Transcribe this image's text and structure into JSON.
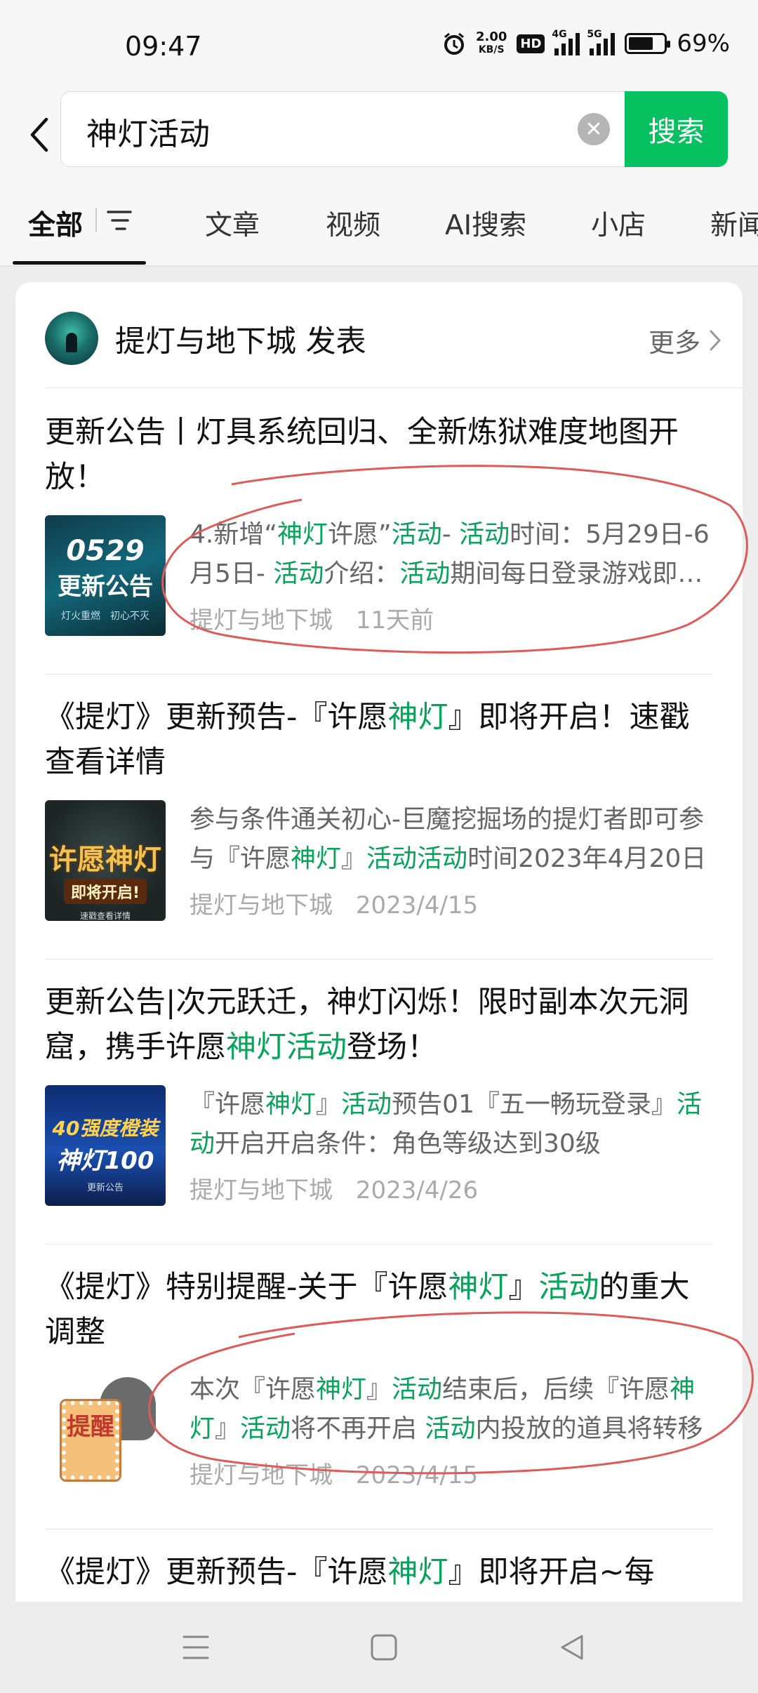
{
  "status_bar": {
    "time": "09:47",
    "net_speed_value": "2.00",
    "net_speed_unit": "KB/S",
    "hd_label": "HD",
    "signal_label_1": "4G",
    "signal_label_2": "5G",
    "battery": "69%"
  },
  "search": {
    "query": "神灯活动",
    "button_label": "搜索"
  },
  "tabs": [
    {
      "label": "全部",
      "active": true
    },
    {
      "label": "文章"
    },
    {
      "label": "视频"
    },
    {
      "label": "AI搜索"
    },
    {
      "label": "小店"
    },
    {
      "label": "新闻"
    }
  ],
  "account": {
    "name": "提灯与地下城 发表",
    "more_label": "更多"
  },
  "articles": [
    {
      "title": "更新公告丨灯具系统回归、全新炼狱难度地图开放！",
      "thumb": {
        "big": "0529",
        "mid": "更新公告",
        "small": "灯火重燃　初心不灭"
      },
      "snippet": [
        {
          "t": "4.新增“",
          "h": false
        },
        {
          "t": "神灯",
          "h": true
        },
        {
          "t": "许愿”",
          "h": false
        },
        {
          "t": "活动",
          "h": true
        },
        {
          "t": "- ",
          "h": false
        },
        {
          "t": "活动",
          "h": true
        },
        {
          "t": "时间：5月29日-6月5日- ",
          "h": false
        },
        {
          "t": "活动",
          "h": true
        },
        {
          "t": "介绍：",
          "h": false
        },
        {
          "t": "活动",
          "h": true
        },
        {
          "t": "期间每日登录游戏即可获得",
          "h": false
        }
      ],
      "source": "提灯与地下城",
      "date": "11天前"
    },
    {
      "title_parts": [
        {
          "t": "《提灯》更新预告-『许愿",
          "h": false
        },
        {
          "t": "神灯",
          "h": true
        },
        {
          "t": "』即将开启！速戳查看详情",
          "h": false
        }
      ],
      "thumb": {
        "big": "许愿神灯",
        "mid": "即将开启!",
        "small": "速戳查看详情"
      },
      "snippet": [
        {
          "t": "参与条件通关初心-巨魔挖掘场的提灯者即可参与『许愿",
          "h": false
        },
        {
          "t": "神灯",
          "h": true
        },
        {
          "t": "』",
          "h": false
        },
        {
          "t": "活动活动",
          "h": true
        },
        {
          "t": "时间2023年4月20日",
          "h": false
        }
      ],
      "source": "提灯与地下城",
      "date": "2023/4/15"
    },
    {
      "title_parts": [
        {
          "t": "更新公告|次元跃迁，神灯闪烁！限时副本次元洞窟，携手许愿",
          "h": false
        },
        {
          "t": "神灯活动",
          "h": true
        },
        {
          "t": "登场！",
          "h": false
        }
      ],
      "thumb": {
        "big": "40强度橙装",
        "mid": "神灯100",
        "small": "更新公告"
      },
      "snippet": [
        {
          "t": "『许愿",
          "h": false
        },
        {
          "t": "神灯",
          "h": true
        },
        {
          "t": "』",
          "h": false
        },
        {
          "t": "活动",
          "h": true
        },
        {
          "t": "预告01『五一畅玩登录』",
          "h": false
        },
        {
          "t": "活动",
          "h": true
        },
        {
          "t": "开启开启条件：角色等级达到30级",
          "h": false
        }
      ],
      "source": "提灯与地下城",
      "date": "2023/4/26"
    },
    {
      "title_parts": [
        {
          "t": "《提灯》特别提醒-关于『许愿",
          "h": false
        },
        {
          "t": "神灯",
          "h": true
        },
        {
          "t": "』",
          "h": false
        },
        {
          "t": "活动",
          "h": true
        },
        {
          "t": "的重大调整",
          "h": false
        }
      ],
      "thumb": {
        "big": "提醒"
      },
      "snippet": [
        {
          "t": "本次『许愿",
          "h": false
        },
        {
          "t": "神灯",
          "h": true
        },
        {
          "t": "』",
          "h": false
        },
        {
          "t": "活动",
          "h": true
        },
        {
          "t": "结束后，后续『许愿",
          "h": false
        },
        {
          "t": "神灯",
          "h": true
        },
        {
          "t": "』",
          "h": false
        },
        {
          "t": "活动",
          "h": true
        },
        {
          "t": "将不再开启 ",
          "h": false
        },
        {
          "t": "活动",
          "h": true
        },
        {
          "t": "内投放的道具将转移",
          "h": false
        }
      ],
      "source": "提灯与地下城",
      "date": "2023/4/15"
    },
    {
      "title_parts": [
        {
          "t": "《提灯》更新预告-『许愿",
          "h": false
        },
        {
          "t": "神灯",
          "h": true
        },
        {
          "t": "』即将开启~每",
          "h": false
        }
      ]
    }
  ],
  "colors": {
    "accent_green": "#07c160",
    "highlight_green": "#07a35a",
    "annotation_red": "#e05a5a"
  }
}
